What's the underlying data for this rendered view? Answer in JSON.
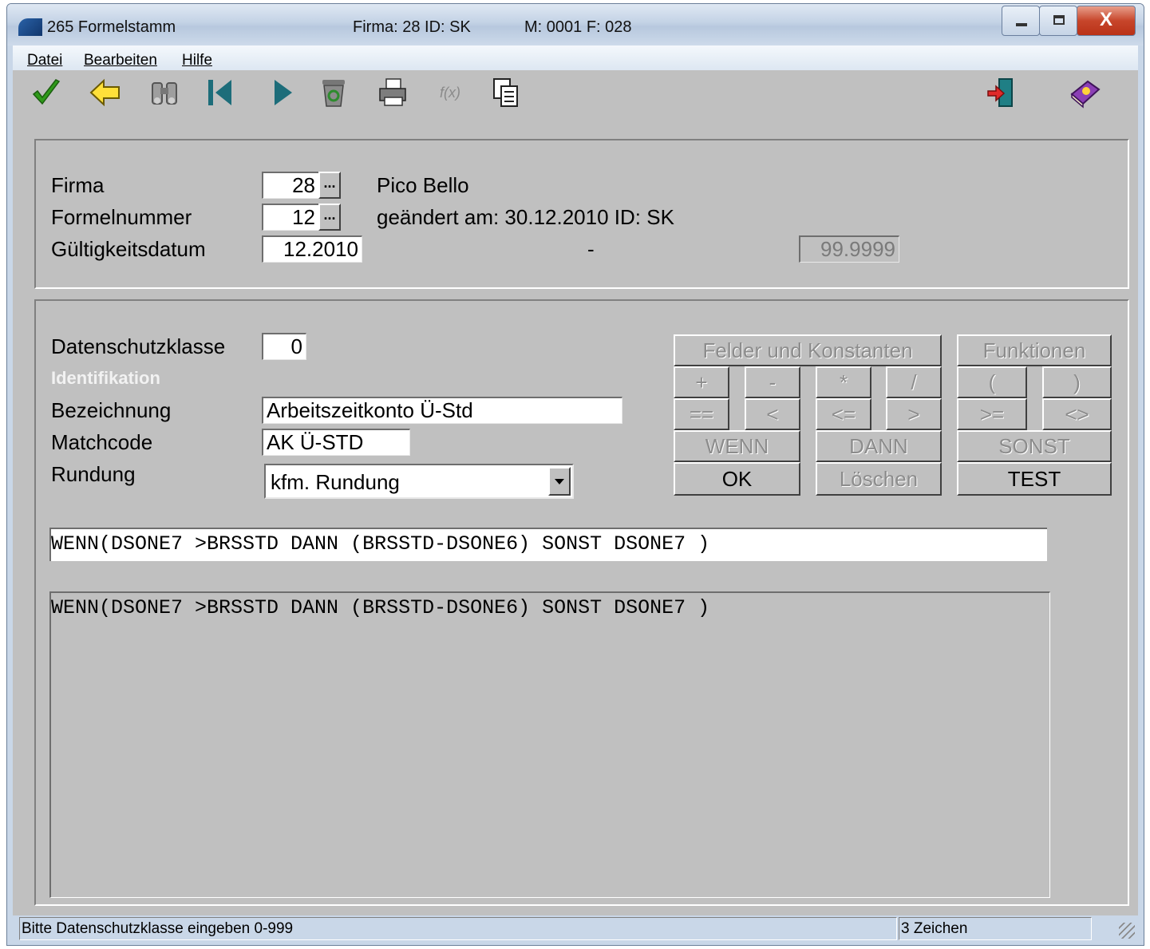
{
  "titlebar": {
    "title": "265 Formelstamm",
    "firma": "Firma:  28  ID: SK",
    "mandant": "M: 0001 F: 028",
    "close_glyph": "X"
  },
  "menu": [
    "Datei",
    "Bearbeiten",
    "Hilfe"
  ],
  "toolbar": {
    "icons": [
      "checkmark-icon",
      "back-arrow-icon",
      "binoculars-icon",
      "first-record-icon",
      "next-record-icon",
      "recycle-bin-icon",
      "printer-icon",
      "formula-icon",
      "copy-icon",
      "exit-door-icon",
      "help-book-icon"
    ],
    "formula_glyph": "f(x)"
  },
  "header": {
    "firma_label": "Firma",
    "firma_value": "28",
    "firma_name": "Pico Bello",
    "formelnummer_label": "Formelnummer",
    "formelnummer_value": "12",
    "changed_info": "geändert am: 30.12.2010 ID: SK",
    "gueltigkeit_label": "Gültigkeitsdatum",
    "gueltig_von": "12.2010",
    "dash": "-",
    "gueltig_bis": "99.9999",
    "dots": "..."
  },
  "details": {
    "datenschutz_label": "Datenschutzklasse",
    "datenschutz_value": "0",
    "section_identifikation": "Identifikation",
    "bezeichnung_label": "Bezeichnung",
    "bezeichnung_value": "Arbeitszeitkonto Ü-Std",
    "matchcode_label": "Matchcode",
    "matchcode_value": "AK Ü-STD",
    "rundung_label": "Rundung",
    "rundung_value": "kfm. Rundung"
  },
  "buttons": {
    "felder": "Felder und Konstanten",
    "funktionen": "Funktionen",
    "plus": "+",
    "minus": "-",
    "mult": "*",
    "div": "/",
    "lparen": "(",
    "rparen": ")",
    "eq": "==",
    "lt": "<",
    "le": "<=",
    "gt": ">",
    "ge": ">=",
    "ne": "<>",
    "wenn": "WENN",
    "dann": "DANN",
    "sonst": "SONST",
    "ok": "OK",
    "loeschen": "Löschen",
    "test": "TEST"
  },
  "formula": {
    "input": "WENN(DSONE7 >BRSSTD DANN (BRSSTD-DSONE6) SONST DSONE7 )",
    "display": "WENN(DSONE7 >BRSSTD DANN (BRSSTD-DSONE6) SONST DSONE7 )"
  },
  "status": {
    "message": "Bitte Datenschutzklasse eingeben 0-999",
    "chars": "3 Zeichen"
  }
}
